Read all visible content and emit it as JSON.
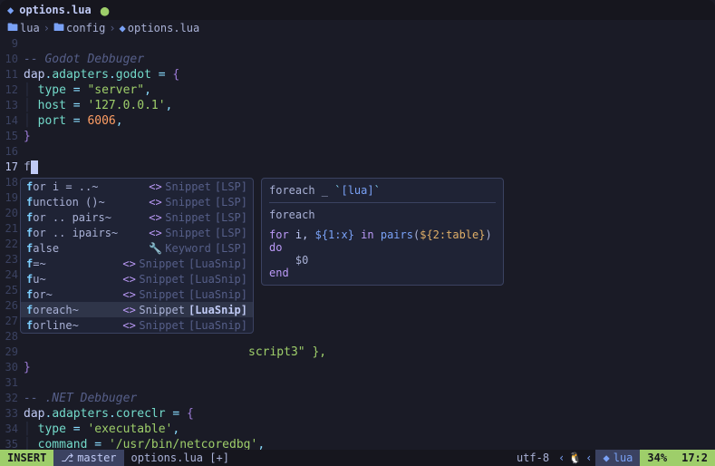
{
  "titlebar": {
    "filename": "options.lua"
  },
  "breadcrumb": {
    "parts": [
      "lua",
      "config",
      "options.lua"
    ]
  },
  "code": {
    "l9": "",
    "l10_comment": "-- Godot Debbuger",
    "l11_a": "dap",
    "l11_b": "adapters",
    "l11_c": "godot",
    "l12_k": "type",
    "l12_v": "\"server\"",
    "l13_k": "host",
    "l13_v": "'127.0.0.1'",
    "l14_k": "port",
    "l14_v": "6006",
    "l17_typed": "f",
    "l29_tail": "script3\" },",
    "l32_comment": "-- .NET Debbuger",
    "l33_a": "dap",
    "l33_b": "adapters",
    "l33_c": "coreclr",
    "l34_k": "type",
    "l34_v": "'executable'",
    "l35_k": "command",
    "l35_v": "'/usr/bin/netcoredbg'"
  },
  "completion": {
    "items": [
      {
        "label_pre": "f",
        "label_rest": "or i = ..~",
        "kind": "Snippet",
        "src": "[LSP]",
        "icon": "<>"
      },
      {
        "label_pre": "f",
        "label_rest": "unction ()~",
        "kind": "Snippet",
        "src": "[LSP]",
        "icon": "<>"
      },
      {
        "label_pre": "f",
        "label_rest": "or .. pairs~",
        "kind": "Snippet",
        "src": "[LSP]",
        "icon": "<>"
      },
      {
        "label_pre": "f",
        "label_rest": "or .. ipairs~",
        "kind": "Snippet",
        "src": "[LSP]",
        "icon": "<>"
      },
      {
        "label_pre": "f",
        "label_rest": "alse",
        "kind": "Keyword",
        "src": "[LSP]",
        "icon": "kw"
      },
      {
        "label_pre": "f",
        "label_rest": "=~",
        "kind": "Snippet",
        "src": "[LuaSnip]",
        "icon": "<>"
      },
      {
        "label_pre": "f",
        "label_rest": "u~",
        "kind": "Snippet",
        "src": "[LuaSnip]",
        "icon": "<>"
      },
      {
        "label_pre": "f",
        "label_rest": "or~",
        "kind": "Snippet",
        "src": "[LuaSnip]",
        "icon": "<>"
      },
      {
        "label_pre": "f",
        "label_rest": "oreach~",
        "kind": "Snippet",
        "src": "[LuaSnip]",
        "icon": "<>",
        "selected": true
      },
      {
        "label_pre": "f",
        "label_rest": "orline~",
        "kind": "Snippet",
        "src": "[LuaSnip]",
        "icon": "<>"
      }
    ]
  },
  "doc": {
    "header": "foreach _ `[lua]`",
    "title": "foreach",
    "body1_for": "for",
    "body1_var": " i, ",
    "body1_ph1": "${1:x}",
    "body1_in": " in ",
    "body1_fn": "pairs",
    "body1_open": "(",
    "body1_ph2": "${2:table}",
    "body1_close": ") ",
    "body1_do": "do",
    "body2": "    $0",
    "body3": "end"
  },
  "statusline": {
    "mode": "INSERT",
    "branch": "master",
    "file": "options.lua",
    "modified": "[+]",
    "encoding": "utf-8",
    "lang": "lua",
    "percent": "34%",
    "pos": "17:2"
  }
}
